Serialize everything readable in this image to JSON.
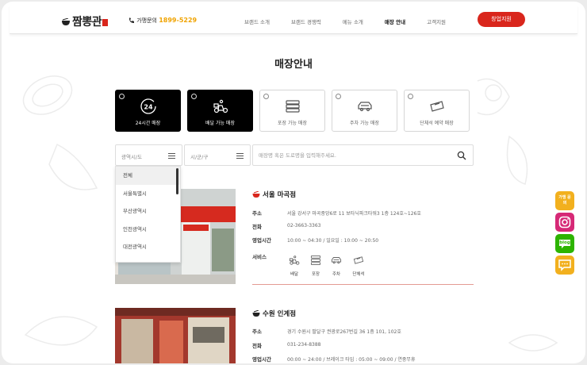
{
  "header": {
    "logo_text": "짬뽕관",
    "phone_label": "가맹문의",
    "phone_number": "1899-5229",
    "nav": [
      "브랜드 소개",
      "브랜드 경쟁력",
      "메뉴 소개",
      "매장 안내",
      "고객지원"
    ],
    "active_nav_index": 3,
    "cta_label": "창업지원",
    "accent_color": "#d9261c"
  },
  "page_title": "매장안내",
  "service_filters": [
    {
      "label": "24시간 매장",
      "icon": "clock-24-icon",
      "selected": true
    },
    {
      "label": "배달 가능 매장",
      "icon": "delivery-scooter-icon",
      "selected": true
    },
    {
      "label": "포장 가능 매장",
      "icon": "takeout-box-icon",
      "selected": false
    },
    {
      "label": "주차 가능 매장",
      "icon": "car-icon",
      "selected": false
    },
    {
      "label": "단체석 예약 매장",
      "icon": "ticket-icon",
      "selected": false
    }
  ],
  "search": {
    "region_placeholder": "광역시/도",
    "district_placeholder": "시/군/구",
    "keyword_placeholder": "매장명 혹은 도로명을 입력해주세요."
  },
  "region_options": [
    "전체",
    "서울특별시",
    "부산광역시",
    "인천광역시",
    "대전광역시"
  ],
  "stores": [
    {
      "name": "서울 마곡점",
      "address_label": "주소",
      "address": "서울 강서구 마곡중앙6로 11 보타닉파크타워3 1층 124호~126호",
      "phone_label": "전화",
      "phone": "02-3663-3363",
      "hours_label": "영업시간",
      "hours": "10:00 ~ 04:30 / 일요일 : 10:00 ~ 20:50",
      "service_label": "서비스",
      "services": [
        "배달",
        "포장",
        "주차",
        "단체석"
      ]
    },
    {
      "name": "수원 인계점",
      "address_label": "주소",
      "address": "경기 수원시 팔달구 권광로267번길 36 1층 101, 102호",
      "phone_label": "전화",
      "phone": "031-234-8388",
      "hours_label": "영업시간",
      "hours": "00:00 ~ 24:00 / 브레이크 타임 : 05:00 ~ 09:00 / 연중무휴"
    }
  ],
  "side_buttons": [
    {
      "label": "가맹 문의",
      "icon": "franchise-inquiry-icon",
      "color": "#f2b01e"
    },
    {
      "label": "",
      "icon": "instagram-icon",
      "color": "#d62976"
    },
    {
      "label": "blog",
      "icon": "blog-icon",
      "color": "#2db400"
    },
    {
      "label": "",
      "icon": "talk-bubble-icon",
      "color": "#f2b01e"
    }
  ]
}
